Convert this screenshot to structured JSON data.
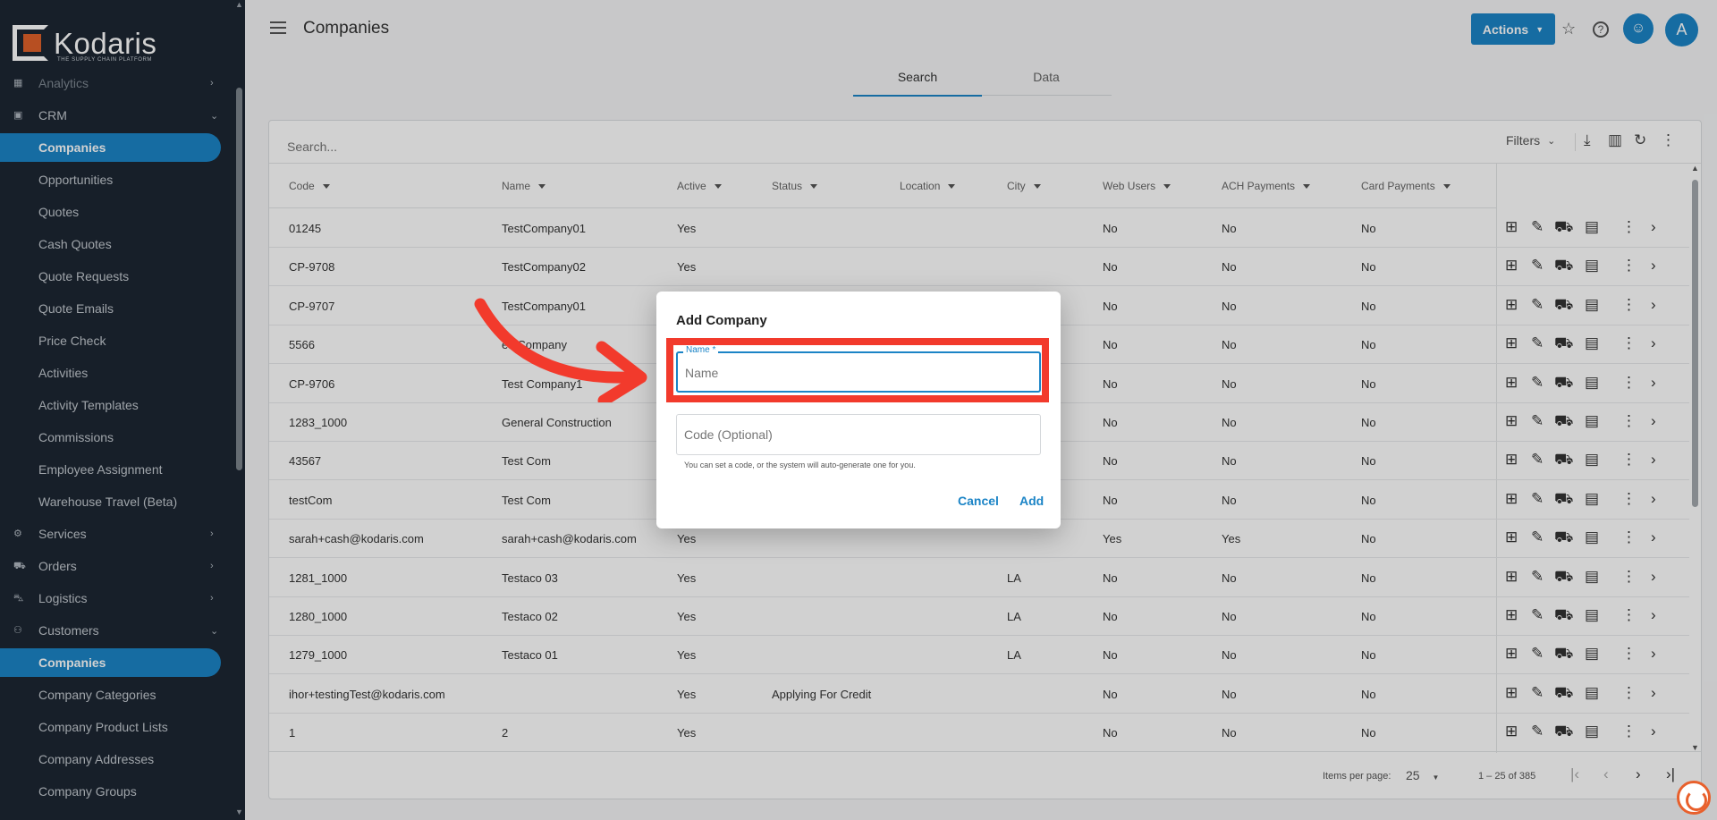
{
  "app": {
    "logo_text": "Kodaris",
    "logo_sub": "THE SUPPLY CHAIN PLATFORM"
  },
  "sidebar": {
    "items": [
      {
        "label": "Analytics",
        "icon": "chart-icon",
        "type": "section",
        "expanded": false
      },
      {
        "label": "CRM",
        "icon": "contact-card-icon",
        "type": "section",
        "expanded": true
      },
      {
        "label": "Companies",
        "type": "child",
        "active": true
      },
      {
        "label": "Opportunities",
        "type": "child"
      },
      {
        "label": "Quotes",
        "type": "child"
      },
      {
        "label": "Cash Quotes",
        "type": "child"
      },
      {
        "label": "Quote Requests",
        "type": "child"
      },
      {
        "label": "Quote Emails",
        "type": "child"
      },
      {
        "label": "Price Check",
        "type": "child"
      },
      {
        "label": "Activities",
        "type": "child"
      },
      {
        "label": "Activity Templates",
        "type": "child"
      },
      {
        "label": "Commissions",
        "type": "child"
      },
      {
        "label": "Employee Assignment",
        "type": "child"
      },
      {
        "label": "Warehouse Travel (Beta)",
        "type": "child"
      },
      {
        "label": "Services",
        "icon": "gears-icon",
        "type": "section",
        "expanded": false
      },
      {
        "label": "Orders",
        "icon": "truck-icon",
        "type": "section",
        "expanded": false
      },
      {
        "label": "Logistics",
        "icon": "delivery-icon",
        "type": "section",
        "expanded": false
      },
      {
        "label": "Customers",
        "icon": "people-icon",
        "type": "section",
        "expanded": true
      },
      {
        "label": "Companies",
        "type": "child",
        "active": true
      },
      {
        "label": "Company Categories",
        "type": "child"
      },
      {
        "label": "Company Product Lists",
        "type": "child"
      },
      {
        "label": "Company Addresses",
        "type": "child"
      },
      {
        "label": "Company Groups",
        "type": "child"
      }
    ]
  },
  "header": {
    "title": "Companies",
    "actions_label": "Actions",
    "avatar_initial": "A"
  },
  "tabs": [
    {
      "label": "Search",
      "active": true
    },
    {
      "label": "Data",
      "active": false
    }
  ],
  "toolbar": {
    "search_placeholder": "Search...",
    "filters_label": "Filters"
  },
  "table": {
    "columns": [
      "Code",
      "Name",
      "Active",
      "Status",
      "Location",
      "City",
      "Web Users",
      "ACH Payments",
      "Card Payments"
    ],
    "rows": [
      [
        "01245",
        "TestCompany01",
        "Yes",
        "",
        "",
        "",
        "No",
        "No",
        "No"
      ],
      [
        "CP-9708",
        "TestCompany02",
        "Yes",
        "",
        "",
        "",
        "No",
        "No",
        "No"
      ],
      [
        "CP-9707",
        "TestCompany01",
        "",
        "",
        "",
        "",
        "No",
        "No",
        "No"
      ],
      [
        "5566",
        "estCompany",
        "",
        "",
        "",
        "",
        "No",
        "No",
        "No"
      ],
      [
        "CP-9706",
        "Test Company1",
        "",
        "",
        "",
        "",
        "No",
        "No",
        "No"
      ],
      [
        "1283_1000",
        "General Construction",
        "",
        "",
        "",
        "",
        "No",
        "No",
        "No"
      ],
      [
        "43567",
        "Test Com",
        "",
        "",
        "",
        "",
        "No",
        "No",
        "No"
      ],
      [
        "testCom",
        "Test Com",
        "",
        "",
        "",
        "",
        "No",
        "No",
        "No"
      ],
      [
        "sarah+cash@kodaris.com",
        "sarah+cash@kodaris.com",
        "Yes",
        "",
        "",
        "",
        "Yes",
        "Yes",
        "No"
      ],
      [
        "1281_1000",
        "Testaco 03",
        "Yes",
        "",
        "",
        "LA",
        "No",
        "No",
        "No"
      ],
      [
        "1280_1000",
        "Testaco 02",
        "Yes",
        "",
        "",
        "LA",
        "No",
        "No",
        "No"
      ],
      [
        "1279_1000",
        "Testaco 01",
        "Yes",
        "",
        "",
        "LA",
        "No",
        "No",
        "No"
      ],
      [
        "ihor+testingTest@kodaris.com",
        "",
        "Yes",
        "Applying For Credit",
        "",
        "",
        "No",
        "No",
        "No"
      ],
      [
        "1",
        "2",
        "Yes",
        "",
        "",
        "",
        "No",
        "No",
        "No"
      ]
    ],
    "row_action_icons": [
      "add-note-icon",
      "edit-document-icon",
      "shipping-icon",
      "comment-icon",
      "more-vert-icon",
      "chevron-right-icon"
    ]
  },
  "pagination": {
    "items_per_page_label": "Items per page:",
    "items_per_page": "25",
    "range": "1 – 25 of 385"
  },
  "dialog": {
    "title": "Add Company",
    "name_label": "Name *",
    "name_placeholder": "Name",
    "code_placeholder": "Code (Optional)",
    "hint": "You can set a code, or the system will auto-generate one for you.",
    "cancel_label": "Cancel",
    "add_label": "Add"
  },
  "colors": {
    "accent": "#1b84c6",
    "sidebar_bg": "#1d2733",
    "highlight": "#f23a2c",
    "logo_orange": "#e0612a"
  }
}
